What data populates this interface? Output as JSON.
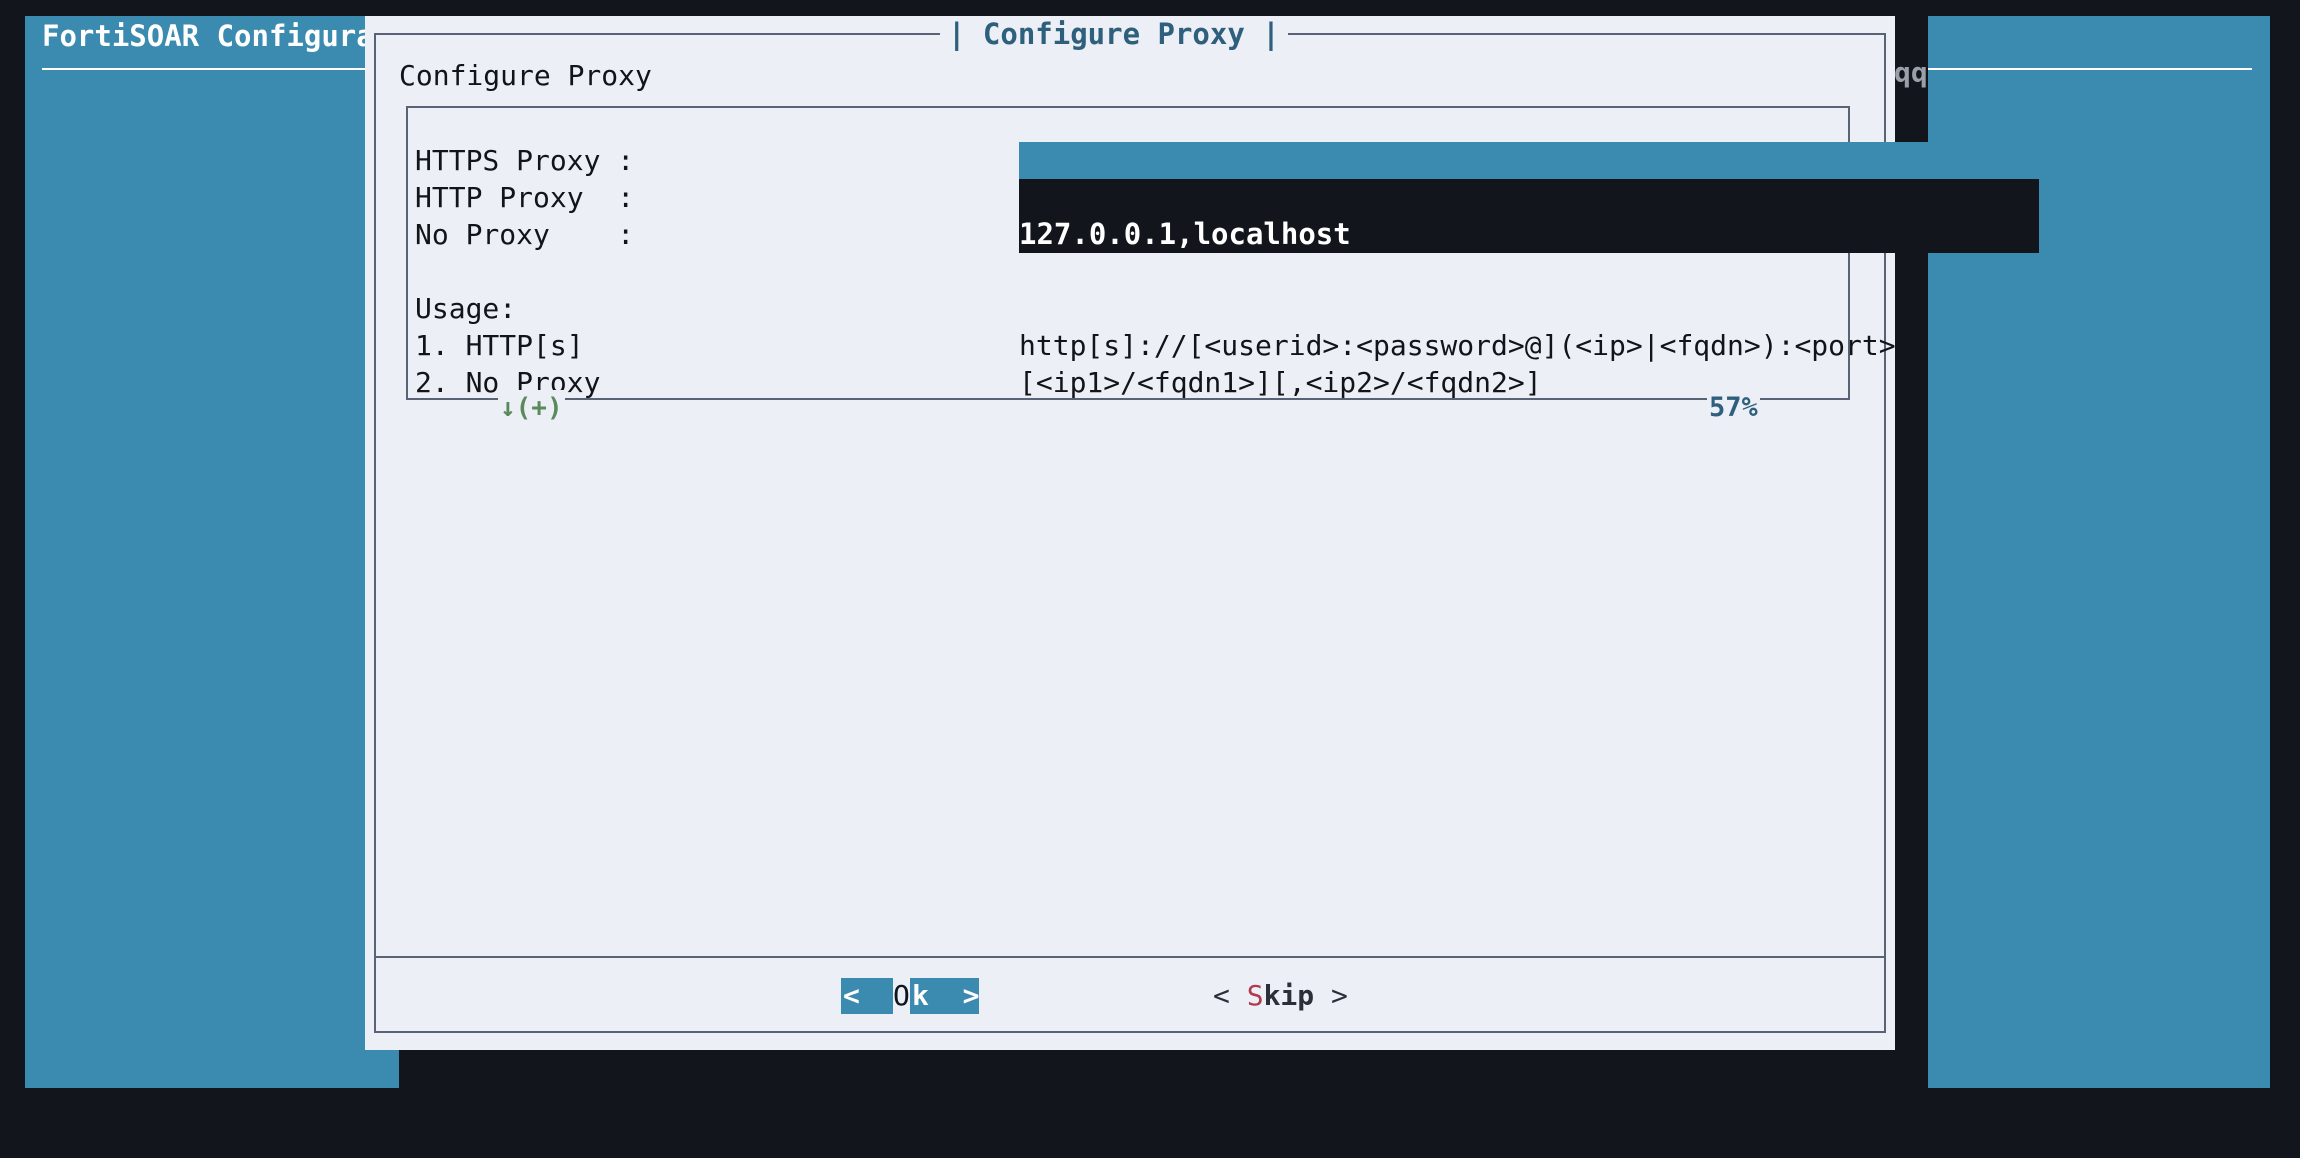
{
  "background": {
    "title": "FortiSOAR Configura",
    "fragment": "qq"
  },
  "dialog": {
    "title": "| Configure Proxy |",
    "subtitle": "Configure Proxy",
    "fields": [
      {
        "label": "HTTPS Proxy :",
        "value": "",
        "state": "focused"
      },
      {
        "label": "HTTP Proxy  :",
        "value": "",
        "state": "normal"
      },
      {
        "label": "No Proxy    :",
        "value": "127.0.0.1,localhost",
        "state": "normal"
      }
    ],
    "usage": {
      "heading": "Usage:",
      "lines": [
        {
          "label": "1. HTTP[s]",
          "text": "http[s]://[<userid>:<password>@](<ip>|<fqdn>):<port>"
        },
        {
          "label": "2. No Proxy",
          "text": "[<ip1>/<fqdn1>][,<ip2>/<fqdn2>]"
        }
      ]
    },
    "scroll_indicator": "↓(+)",
    "scroll_percent": "57%",
    "buttons": {
      "ok": {
        "left": "<  ",
        "hotkey": "O",
        "right": "k  >"
      },
      "skip": {
        "open": "< ",
        "hotkey": "S",
        "rest": "kip",
        "close": " >"
      }
    }
  },
  "colors": {
    "accent": "#3b8ab0",
    "dialog_bg": "#eceff6",
    "title": "#2e5f7c",
    "hotkey": "#b03a4c",
    "indicator": "#5a8a5a",
    "background": "#12151b"
  }
}
